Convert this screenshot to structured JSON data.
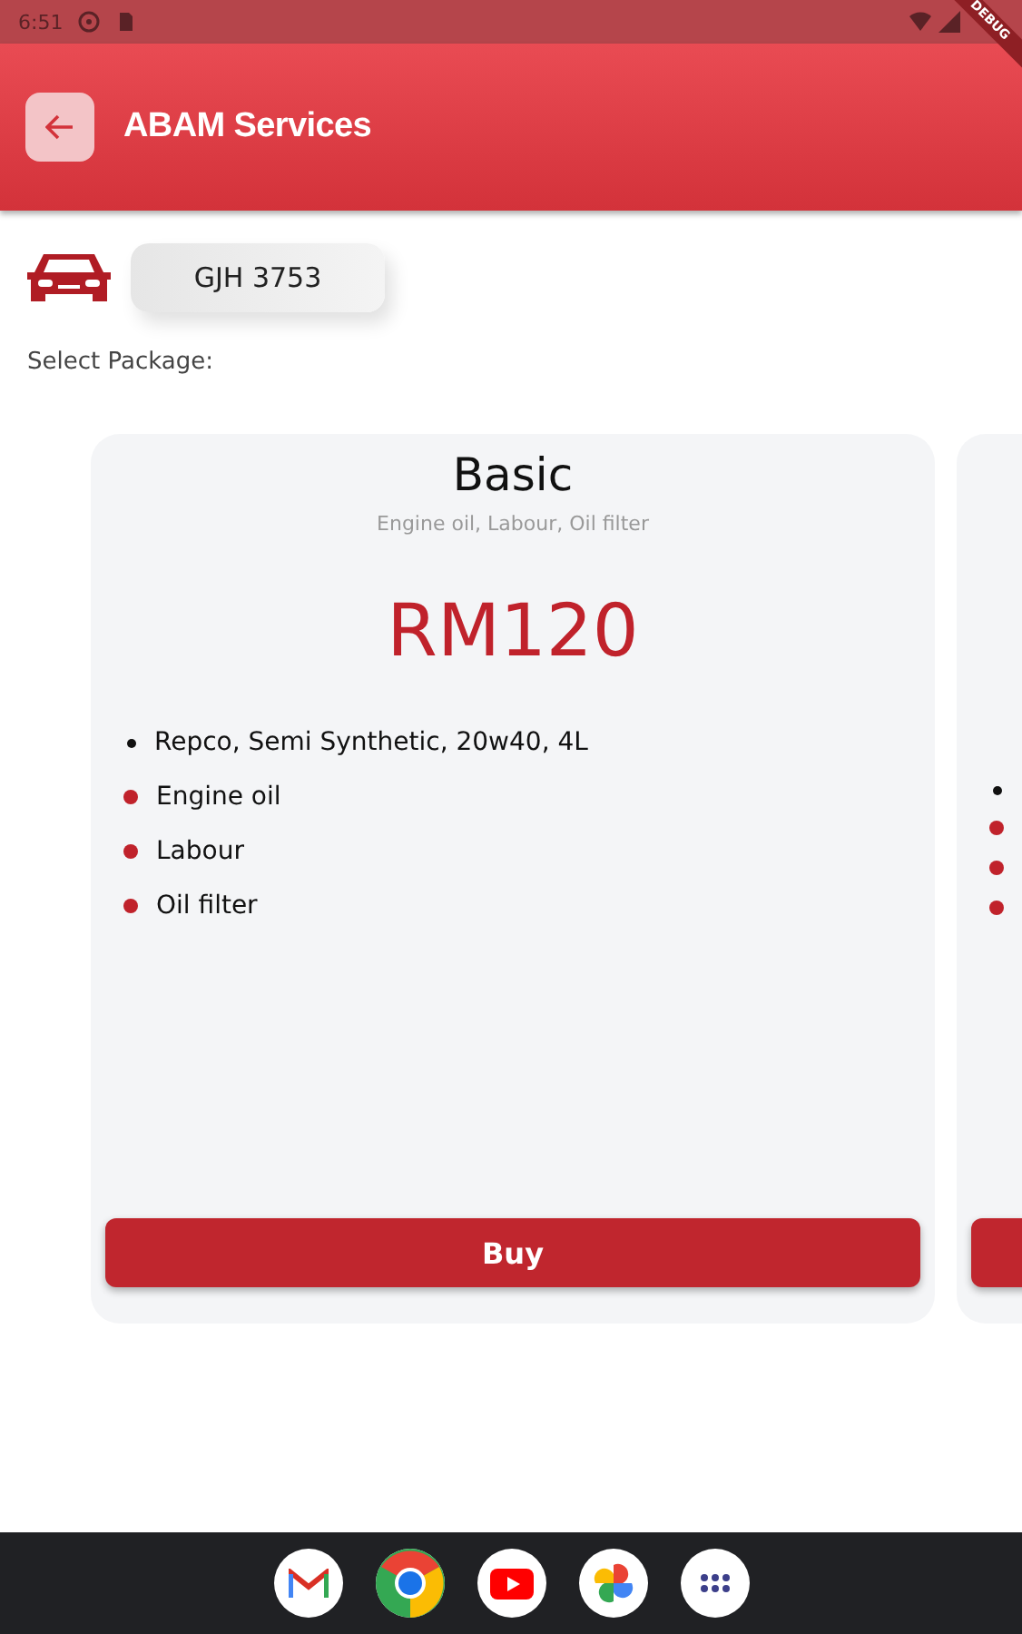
{
  "status_bar": {
    "time": "6:51"
  },
  "debug_banner": {
    "label": "DEBUG"
  },
  "app_bar": {
    "title": "ABAM Services"
  },
  "vehicle": {
    "plate": "GJH 3753"
  },
  "section_label": "Select Package:",
  "packages": [
    {
      "name": "Basic",
      "summary": "Engine oil, Labour, Oil filter",
      "price": "RM120",
      "button": "Buy",
      "items": [
        {
          "kind": "detail",
          "text": "Repco, Semi Synthetic, 20w40, 4L"
        },
        {
          "kind": "included",
          "text": "Engine oil"
        },
        {
          "kind": "included",
          "text": "Labour"
        },
        {
          "kind": "included",
          "text": "Oil filter"
        }
      ]
    }
  ],
  "dock": [
    {
      "kind": "mail"
    },
    {
      "kind": "browser"
    },
    {
      "kind": "video"
    },
    {
      "kind": "photos"
    },
    {
      "kind": "apps"
    }
  ]
}
